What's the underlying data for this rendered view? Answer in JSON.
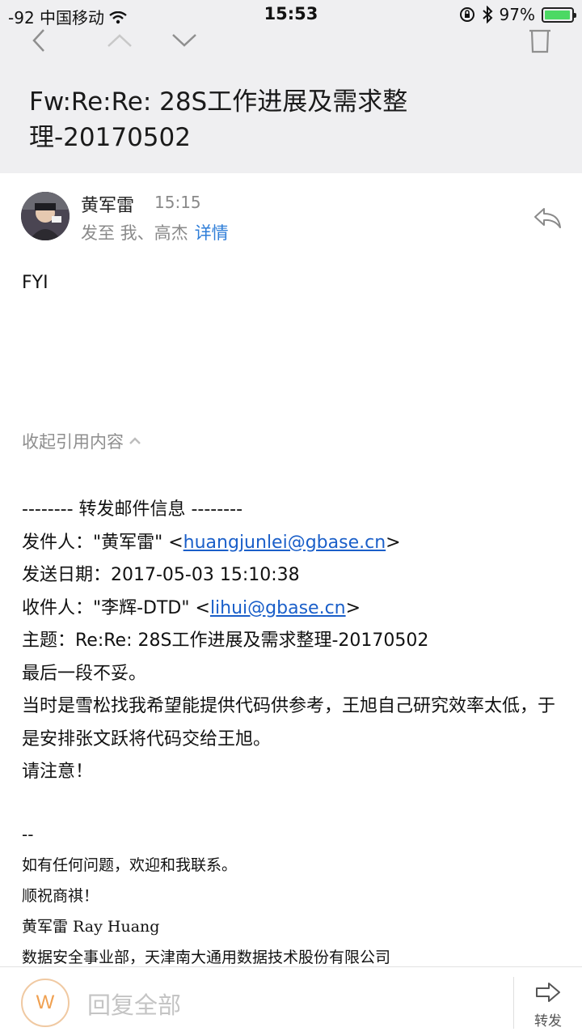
{
  "status": {
    "signal": "-92",
    "carrier": "中国移动",
    "time": "15:53",
    "battery": "97%",
    "battery_level": 0.97
  },
  "subject": "Fw:Re:Re: 28S工作进展及需求整理-20170502",
  "sender": {
    "name": "黄军雷",
    "time": "15:15",
    "recipients": "发至 我、高杰",
    "details_link": "详情"
  },
  "body": {
    "text": "FYI"
  },
  "collapse_label": "收起引用内容",
  "quoted": {
    "header": "-------- 转发邮件信息 --------",
    "from_label": "发件人：\"黄军雷\" <",
    "from_email": "huangjunlei@gbase.cn",
    "from_close": ">",
    "date_line": "发送日期：2017-05-03 15:10:38",
    "to_label": "收件人：\"李辉-DTD\" <",
    "to_email": "lihui@gbase.cn",
    "to_close": ">",
    "subject_line": "主题：Re:Re: 28S工作进展及需求整理-20170502",
    "line1": "最后一段不妥。",
    "line2": "当时是雪松找我希望能提供代码供参考，王旭自己研究效率太低，于是安排张文跃将代码交给王旭。",
    "line3": "请注意！"
  },
  "signature": {
    "dash": "--",
    "l1": "如有任何问题，欢迎和我联系。",
    "l2": "顺祝商祺！",
    "l3": "黄军雷 Ray Huang",
    "l4": "数据安全事业部，天津南大通用数据技术股份有限公司"
  },
  "bottom": {
    "avatar_letter": "W",
    "reply_all_placeholder": "回复全部",
    "forward_label": "转发"
  },
  "colors": {
    "link": "#1a5fc9",
    "details": "#2f7ed8",
    "battery": "#4cd964",
    "avatar_accent": "#f0a050"
  }
}
